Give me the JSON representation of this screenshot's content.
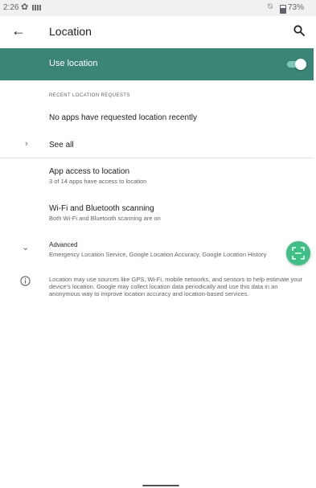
{
  "status_bar": {
    "time": "2:26",
    "battery": "73%"
  },
  "header": {
    "title": "Location"
  },
  "master_switch": {
    "label": "Use location",
    "enabled": true
  },
  "recent_requests": {
    "section_header": "RECENT LOCATION REQUESTS",
    "empty_text": "No apps have requested location recently",
    "see_all_label": "See all"
  },
  "settings": [
    {
      "title": "App access to location",
      "summary": "3 of 14 apps have access to location"
    },
    {
      "title": "Wi-Fi and Bluetooth scanning",
      "summary": "Both Wi-Fi and Bluetooth scanning are on"
    }
  ],
  "advanced": {
    "title": "Advanced",
    "summary": "Emergency Location Service, Google Location Accuracy, Google Location History"
  },
  "footer_text": "Location may use sources like GPS, Wi-Fi, mobile networks, and sensors to help estimate your device's location. Google may collect location data periodically and use this data in an anonymous way to improve location accuracy and location-based services.",
  "colors": {
    "accent": "#3b8574",
    "fab": "#3ebf86"
  },
  "icons": {
    "back": "arrow-back-icon",
    "search": "search-icon",
    "expand": "chevron-right-icon",
    "collapse": "chevron-down-icon",
    "info": "info-icon",
    "fab": "scan-icon"
  }
}
